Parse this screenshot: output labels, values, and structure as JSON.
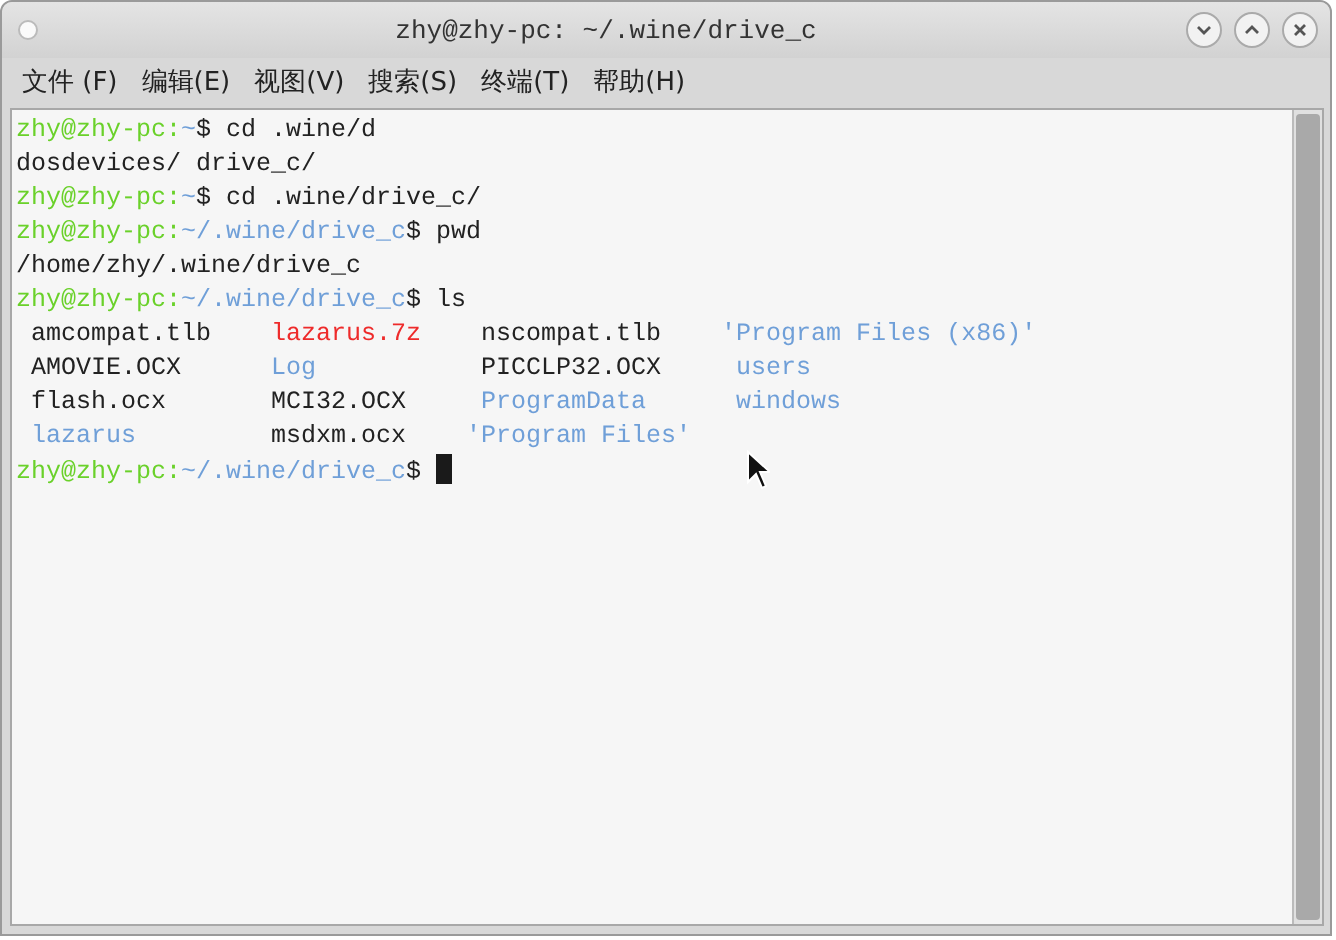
{
  "window": {
    "title": "zhy@zhy-pc: ~/.wine/drive_c"
  },
  "menu": [
    "文件 (F)",
    "编辑(E)",
    "视图(V)",
    "搜索(S)",
    "终端(T)",
    "帮助(H)"
  ],
  "terminal": {
    "lines": [
      {
        "segments": [
          {
            "kind": "user",
            "text": "zhy@zhy-pc:"
          },
          {
            "kind": "path",
            "text": "~"
          },
          {
            "kind": "plain",
            "text": "$ cd .wine/d"
          }
        ]
      },
      {
        "segments": [
          {
            "kind": "plain",
            "text": "dosdevices/ drive_c/"
          }
        ]
      },
      {
        "segments": [
          {
            "kind": "user",
            "text": "zhy@zhy-pc:"
          },
          {
            "kind": "path",
            "text": "~"
          },
          {
            "kind": "plain",
            "text": "$ cd .wine/drive_c/"
          }
        ]
      },
      {
        "segments": [
          {
            "kind": "user",
            "text": "zhy@zhy-pc:"
          },
          {
            "kind": "path",
            "text": "~/.wine/drive_c"
          },
          {
            "kind": "plain",
            "text": "$ pwd"
          }
        ]
      },
      {
        "segments": [
          {
            "kind": "plain",
            "text": "/home/zhy/.wine/drive_c"
          }
        ]
      },
      {
        "segments": [
          {
            "kind": "user",
            "text": "zhy@zhy-pc:"
          },
          {
            "kind": "path",
            "text": "~/.wine/drive_c"
          },
          {
            "kind": "plain",
            "text": "$ ls"
          }
        ]
      }
    ],
    "listing": [
      [
        {
          "kind": "file",
          "text": "amcompat.tlb",
          "quoted": false
        },
        {
          "kind": "archive",
          "text": "lazarus.7z",
          "quoted": false
        },
        {
          "kind": "file",
          "text": "nscompat.tlb",
          "quoted": false
        },
        {
          "kind": "dir",
          "text": "'Program Files (x86)'",
          "quoted": true
        }
      ],
      [
        {
          "kind": "file",
          "text": "AMOVIE.OCX",
          "quoted": false
        },
        {
          "kind": "dir",
          "text": "Log",
          "quoted": false
        },
        {
          "kind": "file",
          "text": "PICCLP32.OCX",
          "quoted": false
        },
        {
          "kind": "dir",
          "text": "users",
          "quoted": false
        }
      ],
      [
        {
          "kind": "file",
          "text": "flash.ocx",
          "quoted": false
        },
        {
          "kind": "file",
          "text": "MCI32.OCX",
          "quoted": false
        },
        {
          "kind": "dir",
          "text": "ProgramData",
          "quoted": false
        },
        {
          "kind": "dir",
          "text": "windows",
          "quoted": false
        }
      ],
      [
        {
          "kind": "dir",
          "text": "lazarus",
          "quoted": false
        },
        {
          "kind": "file",
          "text": "msdxm.ocx",
          "quoted": false
        },
        {
          "kind": "dir",
          "text": "'Program Files'",
          "quoted": true
        }
      ]
    ],
    "prompt": {
      "segments": [
        {
          "kind": "user",
          "text": "zhy@zhy-pc:"
        },
        {
          "kind": "path",
          "text": "~/.wine/drive_c"
        },
        {
          "kind": "plain",
          "text": "$ "
        }
      ]
    }
  }
}
